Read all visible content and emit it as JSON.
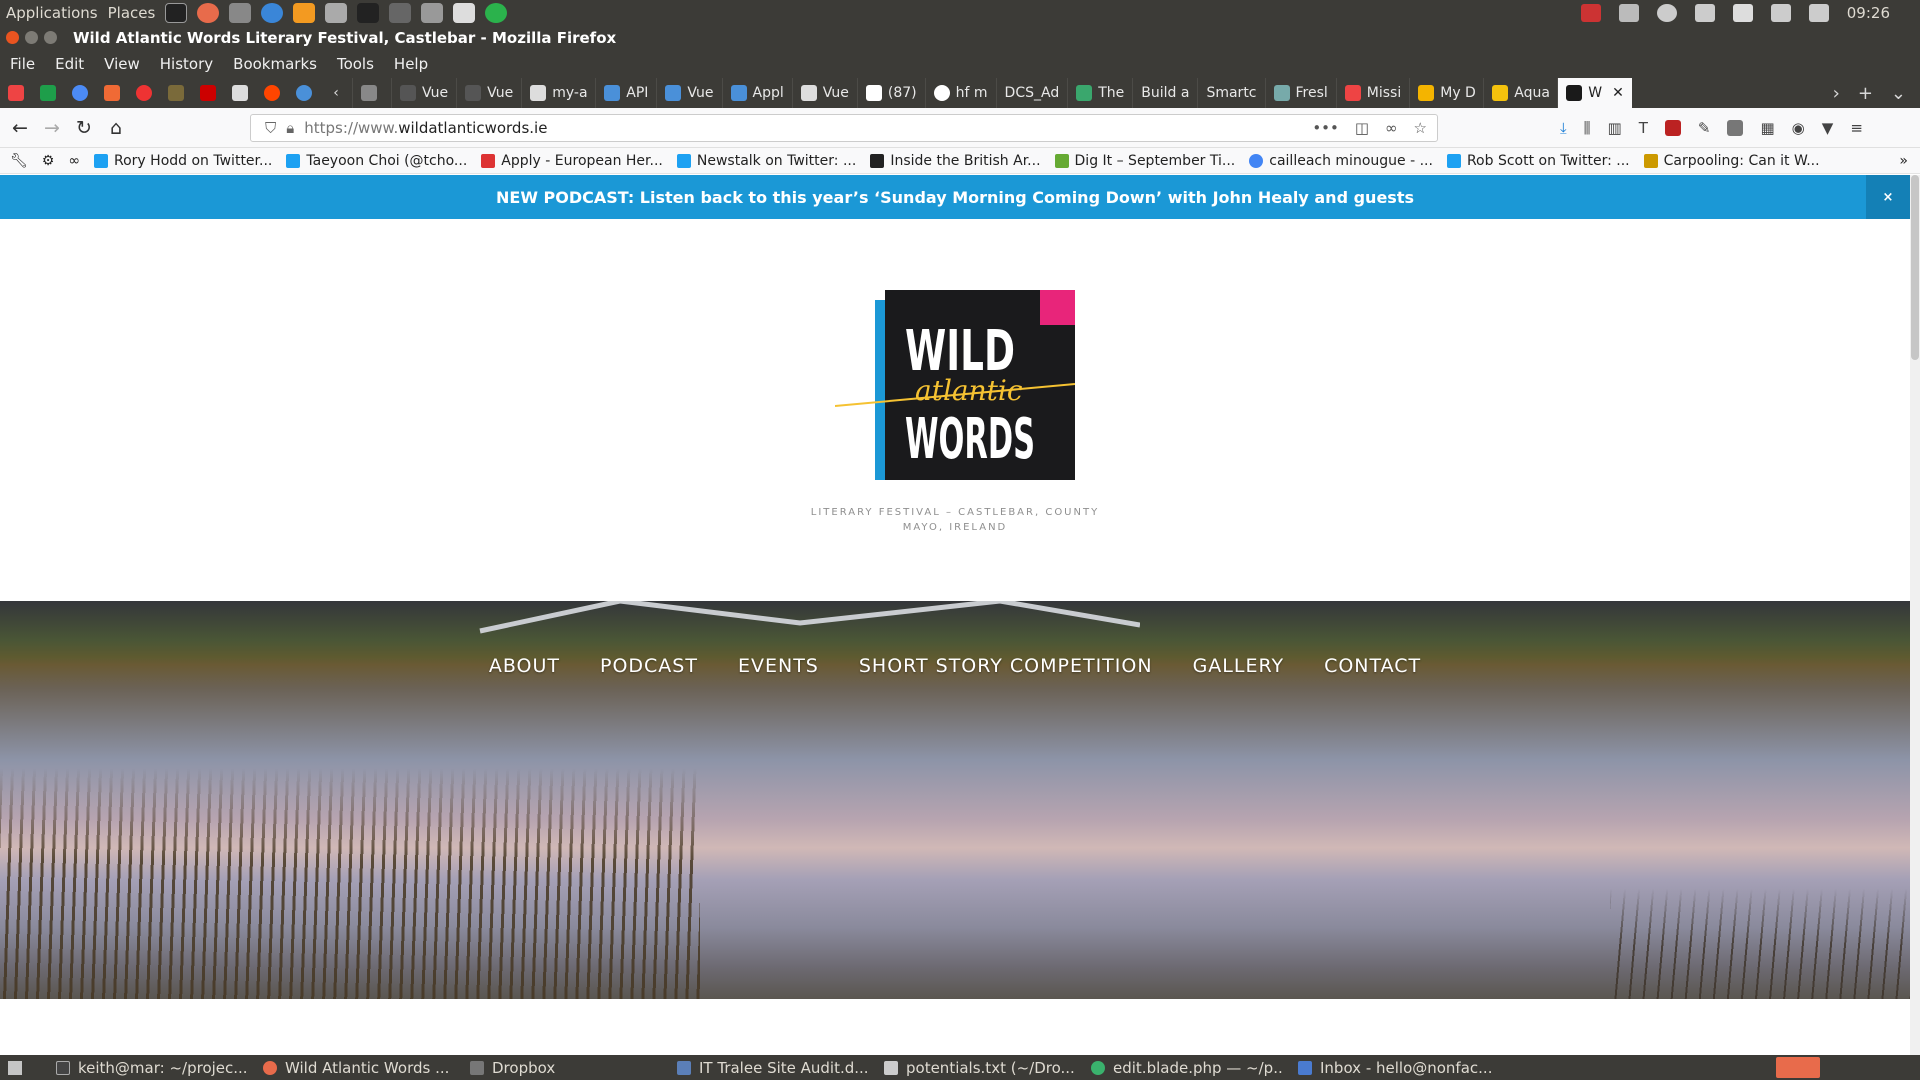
{
  "panel": {
    "applications": "Applications",
    "places": "Places",
    "clock": "09:26"
  },
  "window": {
    "title": "Wild Atlantic Words Literary Festival, Castlebar - Mozilla Firefox"
  },
  "menu": [
    "File",
    "Edit",
    "View",
    "History",
    "Bookmarks",
    "Tools",
    "Help"
  ],
  "tabs": [
    {
      "label": "",
      "color": "#888"
    },
    {
      "label": "Vue",
      "color": "#555"
    },
    {
      "label": "Vue",
      "color": "#555"
    },
    {
      "label": "my-a",
      "color": "#ddd"
    },
    {
      "label": "API",
      "color": "#4a90d9"
    },
    {
      "label": "Vue",
      "color": "#4a90d9"
    },
    {
      "label": "Appl",
      "color": "#4a90d9"
    },
    {
      "label": "Vue",
      "color": "#ddd"
    },
    {
      "label": "(87)",
      "color": "#ffffff"
    },
    {
      "label": "hf m",
      "color": "#ffffff"
    },
    {
      "label": "DCS_Ad",
      "color": "#3c3b37"
    },
    {
      "label": "The",
      "color": "#3aa76d"
    },
    {
      "label": "Build a",
      "color": "#3c3b37"
    },
    {
      "label": "Smartc",
      "color": "#3c3b37"
    },
    {
      "label": "Fresl",
      "color": "#7aa"
    },
    {
      "label": "Missi",
      "color": "#e44"
    },
    {
      "label": "My D",
      "color": "#f4b400"
    },
    {
      "label": "Aqua",
      "color": "#f4c20d"
    }
  ],
  "active_tab": {
    "label": "W"
  },
  "url": {
    "prefix": "https://www.",
    "domain": "wildatlanticwords.ie"
  },
  "bookmarks": [
    {
      "label": "Rory Hodd on Twitter...",
      "color": "#1da1f2"
    },
    {
      "label": "Taeyoon Choi (@tcho...",
      "color": "#1da1f2"
    },
    {
      "label": "Apply - European Her...",
      "color": "#d33"
    },
    {
      "label": "Newstalk on Twitter: ...",
      "color": "#1da1f2"
    },
    {
      "label": "Inside the British Ar...",
      "color": "#222"
    },
    {
      "label": "Dig It – September Ti...",
      "color": "#6a3"
    },
    {
      "label": "cailleach minougue - ...",
      "color": "#4285f4"
    },
    {
      "label": "Rob Scott on Twitter: ...",
      "color": "#1da1f2"
    },
    {
      "label": "Carpooling: Can it W...",
      "color": "#c90"
    }
  ],
  "site": {
    "announcement": "NEW PODCAST: Listen back to this year’s ‘Sunday Morning Coming Down’ with John Healy and guests",
    "close": "×",
    "logo": {
      "line1": "WILD",
      "line2": "atlantic",
      "line3": "WORDS"
    },
    "tagline": "LITERARY FESTIVAL – CASTLEBAR, COUNTY MAYO, IRELAND",
    "nav": [
      "ABOUT",
      "PODCAST",
      "EVENTS",
      "SHORT STORY COMPETITION",
      "GALLERY",
      "CONTACT"
    ],
    "colors": {
      "announce": "#1b98d6",
      "logo_blue": "#1b98d6",
      "logo_pink": "#e8257a",
      "logo_yellow": "#f5c232"
    }
  },
  "taskbar": [
    {
      "label": "keith@mar: ~/projec...",
      "color": "#444"
    },
    {
      "label": "Wild Atlantic Words ...",
      "color": "#e86b4b"
    },
    {
      "label": "Dropbox",
      "color": "#777"
    },
    {
      "label": "IT Tralee Site Audit.d...",
      "color": "#5b7fb8"
    },
    {
      "label": "potentials.txt (~/Dro...",
      "color": "#ccc"
    },
    {
      "label": "edit.blade.php — ~/p...",
      "color": "#3ab26d"
    },
    {
      "label": "Inbox - hello@nonfac...",
      "color": "#4a7bd0"
    }
  ]
}
